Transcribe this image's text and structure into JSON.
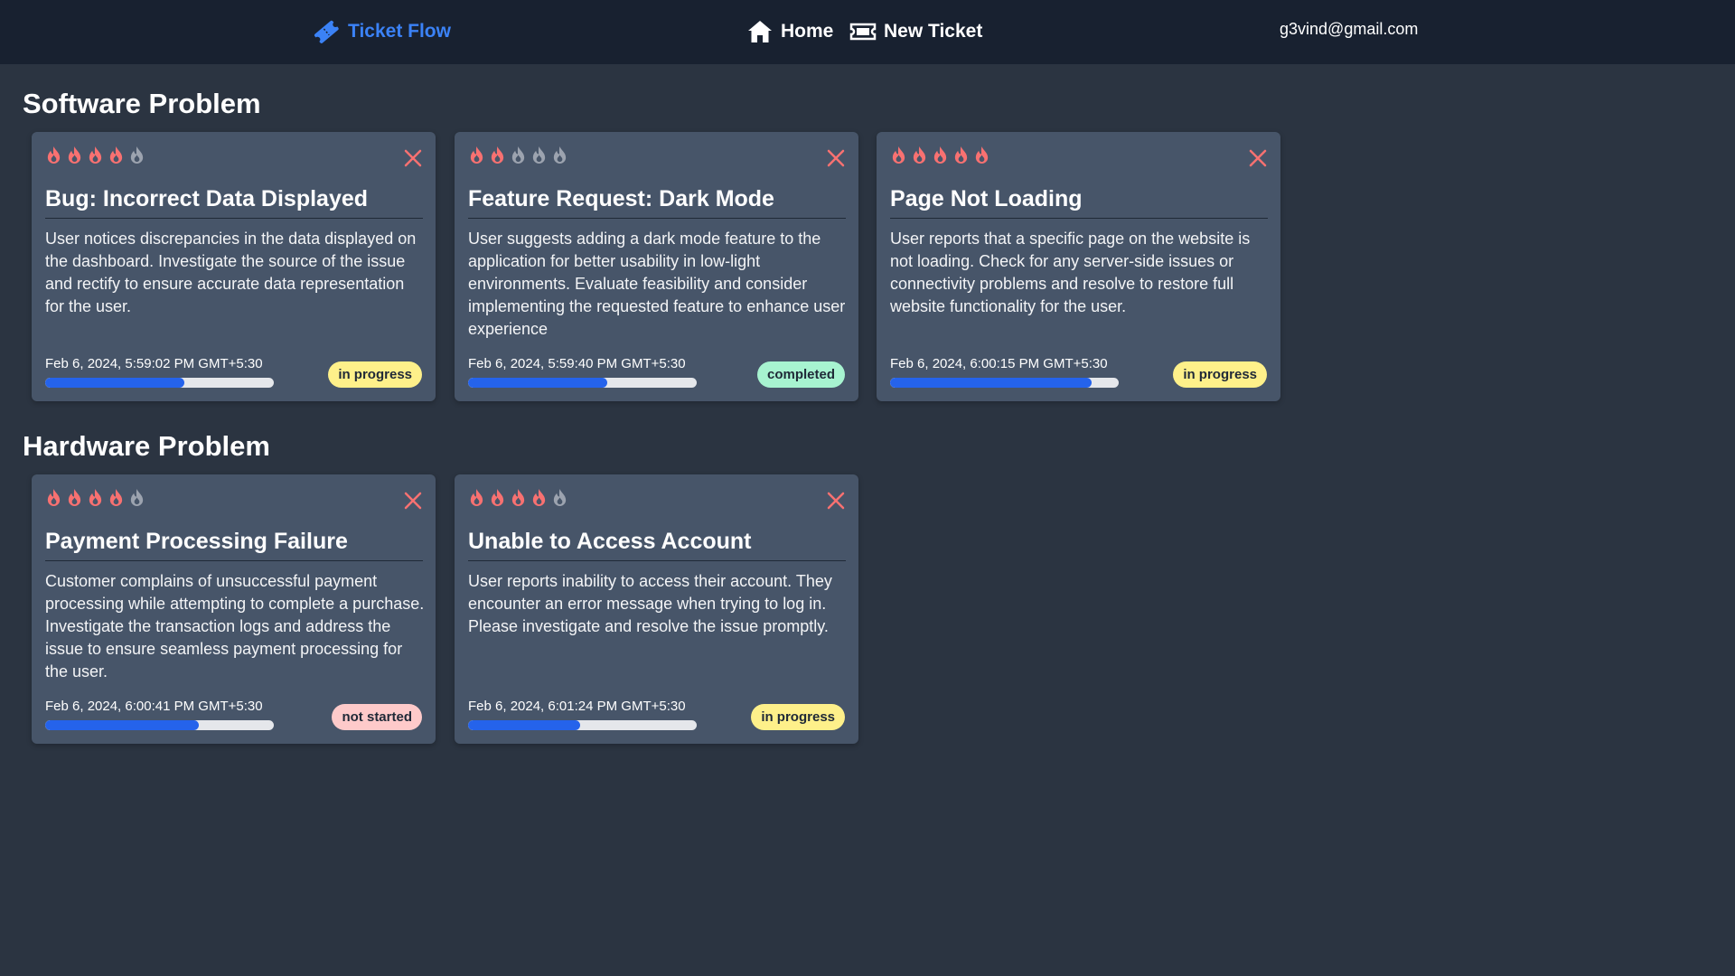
{
  "nav": {
    "brand": "Ticket Flow",
    "home": "Home",
    "new_ticket": "New Ticket",
    "user_email": "g3vind@gmail.com",
    "brand_color": "#3b82f6"
  },
  "colors": {
    "flame_active": "#f87171",
    "flame_inactive": "#9ca3af",
    "close": "#f87171",
    "progress": "#2563eb",
    "status": {
      "in progress": "#fef08a",
      "completed": "#a7f3d0",
      "not started": "#fecaca"
    }
  },
  "sections": [
    {
      "title": "Software Problem",
      "tickets": [
        {
          "title": "Bug: Incorrect Data Displayed",
          "description": "User notices discrepancies in the data displayed on the dashboard. Investigate the source of the issue and rectify to ensure accurate data representation for the user.",
          "date": "Feb 6, 2024, 5:59:02 PM GMT+5:30",
          "priority": 4,
          "progress": 0.61,
          "status": "in progress"
        },
        {
          "title": "Feature Request: Dark Mode",
          "description": "User suggests adding a dark mode feature to the application for better usability in low-light environments. Evaluate feasibility and consider implementing the requested feature to enhance user experience",
          "date": "Feb 6, 2024, 5:59:40 PM GMT+5:30",
          "priority": 2,
          "progress": 0.61,
          "status": "completed"
        },
        {
          "title": "Page Not Loading",
          "description": "User reports that a specific page on the website is not loading. Check for any server-side issues or connectivity problems and resolve to restore full website functionality for the user.",
          "date": "Feb 6, 2024, 6:00:15 PM GMT+5:30",
          "priority": 5,
          "progress": 0.88,
          "status": "in progress"
        }
      ]
    },
    {
      "title": "Hardware Problem",
      "tickets": [
        {
          "title": "Payment Processing Failure",
          "description": "Customer complains of unsuccessful payment processing while attempting to complete a purchase. Investigate the transaction logs and address the issue to ensure seamless payment processing for the user.",
          "date": "Feb 6, 2024, 6:00:41 PM GMT+5:30",
          "priority": 4,
          "progress": 0.67,
          "status": "not started"
        },
        {
          "title": "Unable to Access Account",
          "description": "User reports inability to access their account. They encounter an error message when trying to log in. Please investigate and resolve the issue promptly.",
          "date": "Feb 6, 2024, 6:01:24 PM GMT+5:30",
          "priority": 4,
          "progress": 0.49,
          "status": "in progress"
        }
      ]
    }
  ]
}
